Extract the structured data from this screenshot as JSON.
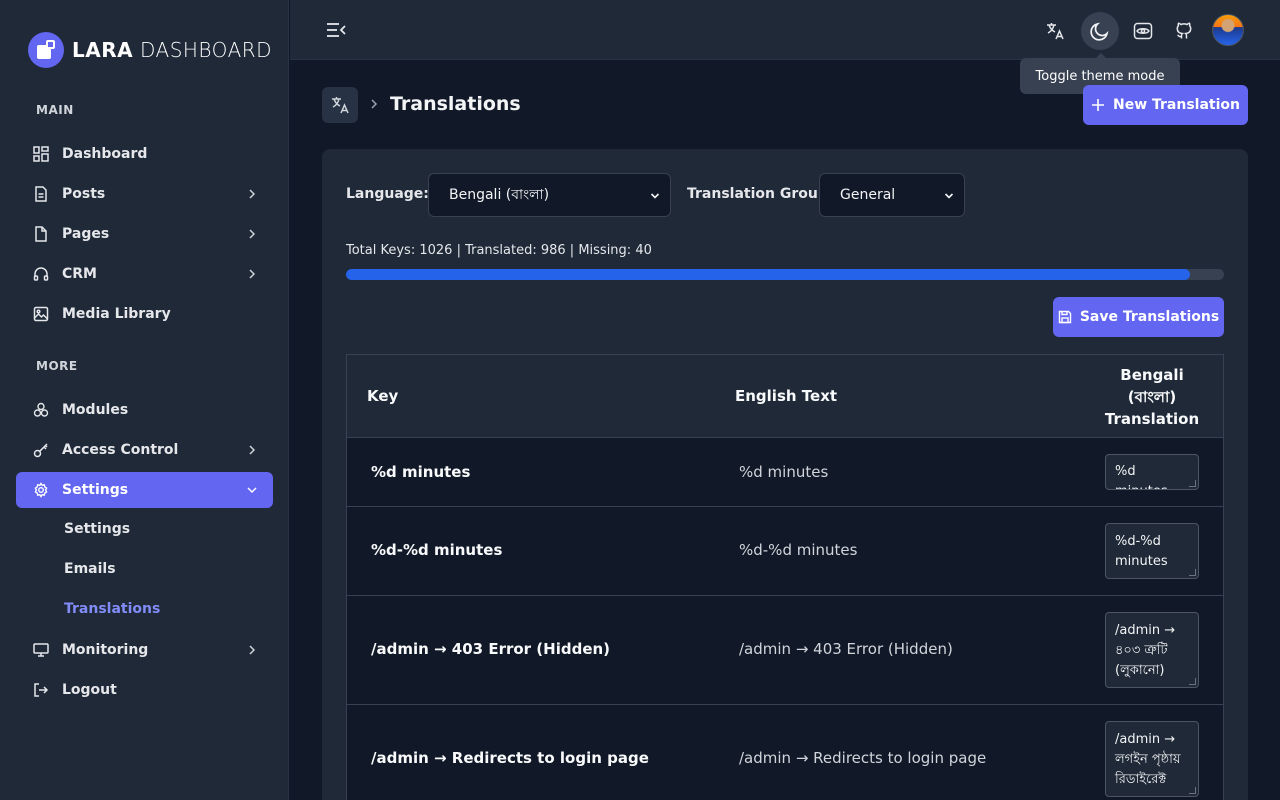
{
  "app": {
    "logo_bold": "LARA",
    "logo_light": "DASHBOARD"
  },
  "sidebar": {
    "main_label": "MAIN",
    "more_label": "MORE",
    "main_items": [
      {
        "label": "Dashboard",
        "icon": "dashboard-icon"
      },
      {
        "label": "Posts",
        "icon": "document-icon"
      },
      {
        "label": "Pages",
        "icon": "page-icon"
      },
      {
        "label": "CRM",
        "icon": "headset-icon"
      },
      {
        "label": "Media Library",
        "icon": "image-icon"
      }
    ],
    "more_items": [
      {
        "label": "Modules",
        "icon": "cubes-icon"
      },
      {
        "label": "Access Control",
        "icon": "key-icon"
      },
      {
        "label": "Settings",
        "icon": "gear-icon"
      }
    ],
    "settings_sub": [
      "Settings",
      "Emails",
      "Translations"
    ],
    "monitoring": "Monitoring",
    "logout": "Logout"
  },
  "header": {
    "tooltip": "Toggle theme mode"
  },
  "page": {
    "title": "Translations",
    "new_button": "New Translation"
  },
  "filters": {
    "language_label": "Language:",
    "language_value": "Bengali (বাংলা)",
    "group_label": "Translation Group:",
    "group_value": "General"
  },
  "stats": {
    "text": "Total Keys: 1026 | Translated: 986 | Missing: 40",
    "progress_percent": 96.1
  },
  "save_button": "Save Translations",
  "table": {
    "col_key": "Key",
    "col_english": "English Text",
    "col_translation_1": "Bengali",
    "col_translation_2": "(বাংলা)",
    "col_translation_3": "Translation",
    "rows": [
      {
        "key": "%d minutes",
        "english": "%d minutes",
        "translation": "%d minutes"
      },
      {
        "key": "%d-%d minutes",
        "english": "%d-%d minutes",
        "translation": "%d-%d minutes"
      },
      {
        "key": "/admin → 403 Error (Hidden)",
        "english": "/admin → 403 Error (Hidden)",
        "translation": "/admin → ৪০৩ ত্রুটি (লুকানো)"
      },
      {
        "key": "/admin → Redirects to login page",
        "english": "/admin → Redirects to login page",
        "translation": "/admin → লগইন পৃষ্ঠায় রিডাইরেক্ট"
      }
    ]
  },
  "colors": {
    "accent": "#6366f1",
    "progress": "#2563eb",
    "sidebar_bg": "#1f2937",
    "page_bg": "#111827"
  }
}
